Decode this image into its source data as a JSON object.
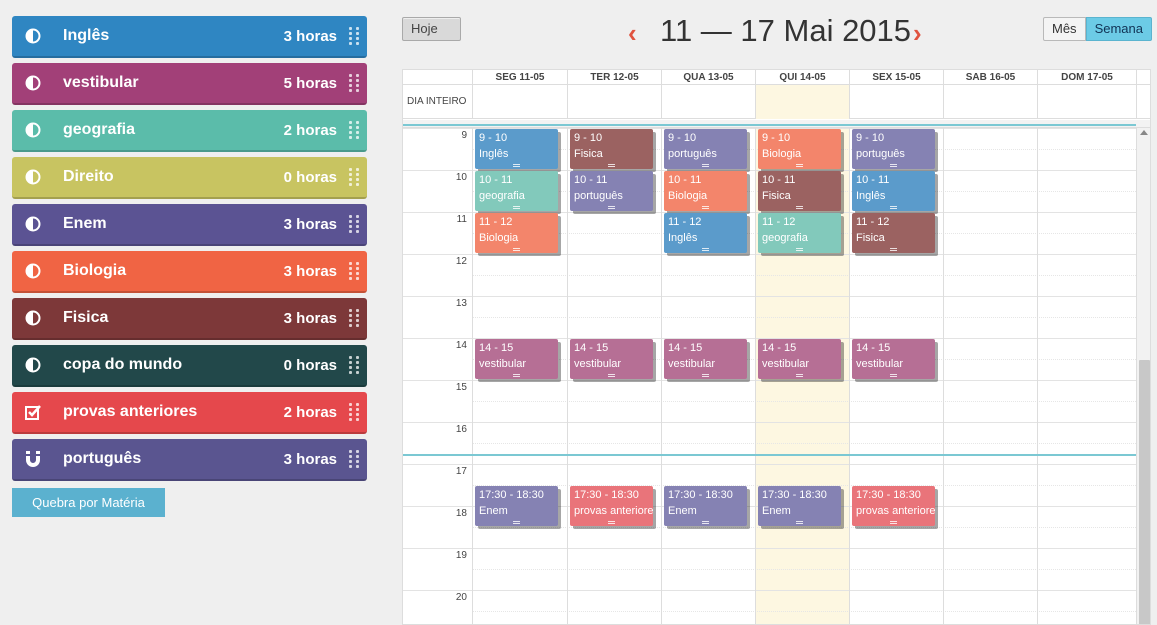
{
  "colors": {
    "ingles": "#2f86c2",
    "vestibular": "#a24078",
    "geografia": "#5bbcaa",
    "direito": "#c8c461",
    "enem": "#5b5393",
    "biologia": "#f06444",
    "fisica": "#7d3839",
    "copa": "#22484a",
    "provas": "#e5484c",
    "portugues": "#5a5590",
    "accent": "#5bb1cf",
    "nav": "#e0533f"
  },
  "sidebar": {
    "items": [
      {
        "name": "Inglês",
        "hours": "3 horas",
        "icon": "half-circle-icon",
        "color": "#2f86c2"
      },
      {
        "name": "vestibular",
        "hours": "5 horas",
        "icon": "half-circle-icon",
        "color": "#a24078"
      },
      {
        "name": "geografia",
        "hours": "2 horas",
        "icon": "half-circle-icon",
        "color": "#5bbcaa"
      },
      {
        "name": "Direito",
        "hours": "0 horas",
        "icon": "half-circle-icon",
        "color": "#c8c461"
      },
      {
        "name": "Enem",
        "hours": "3 horas",
        "icon": "half-circle-icon",
        "color": "#5b5393"
      },
      {
        "name": "Biologia",
        "hours": "3 horas",
        "icon": "half-circle-icon",
        "color": "#f06444"
      },
      {
        "name": "Fisica",
        "hours": "3 horas",
        "icon": "half-circle-icon",
        "color": "#7d3839"
      },
      {
        "name": "copa do mundo",
        "hours": "0 horas",
        "icon": "half-circle-icon",
        "color": "#22484a"
      },
      {
        "name": "provas anteriores",
        "hours": "2 horas",
        "icon": "checkbox-icon",
        "color": "#e5484c"
      },
      {
        "name": "português",
        "hours": "3 horas",
        "icon": "magnet-icon",
        "color": "#5a5590"
      }
    ],
    "breakdown_label": "Quebra por Matéria"
  },
  "toolbar": {
    "today_label": "Hoje",
    "prev_label": "‹",
    "next_label": "›",
    "week_title": "11 — 17 Mai 2015",
    "month_label": "Mês",
    "week_label": "Semana"
  },
  "calendar": {
    "allday_label": "DIA INTEIRO",
    "days": [
      "SEG 11-05",
      "TER 12-05",
      "QUA 13-05",
      "QUI 14-05",
      "SEX 15-05",
      "SAB 16-05",
      "DOM 17-05"
    ],
    "hours": [
      "9",
      "10",
      "11",
      "12",
      "13",
      "14",
      "15",
      "16",
      "17",
      "18",
      "19",
      "20"
    ],
    "events": [
      {
        "day": 0,
        "start": 9,
        "time": "9 - 10",
        "title": "Inglês",
        "color": "#5b9bcb"
      },
      {
        "day": 0,
        "start": 10,
        "time": "10 - 11",
        "title": "geografia",
        "color": "#82c9bb"
      },
      {
        "day": 0,
        "start": 11,
        "time": "11 - 12",
        "title": "Biologia",
        "color": "#f3856b"
      },
      {
        "day": 1,
        "start": 9,
        "time": "9 - 10",
        "title": "Fisica",
        "color": "#9b6261"
      },
      {
        "day": 1,
        "start": 10,
        "time": "10 - 11",
        "title": "português",
        "color": "#8582b3"
      },
      {
        "day": 2,
        "start": 9,
        "time": "9 - 10",
        "title": "português",
        "color": "#8582b3"
      },
      {
        "day": 2,
        "start": 10,
        "time": "10 - 11",
        "title": "Biologia",
        "color": "#f3856b"
      },
      {
        "day": 2,
        "start": 11,
        "time": "11 - 12",
        "title": "Inglês",
        "color": "#5b9bcb"
      },
      {
        "day": 3,
        "start": 9,
        "time": "9 - 10",
        "title": "Biologia",
        "color": "#f3856b"
      },
      {
        "day": 3,
        "start": 10,
        "time": "10 - 11",
        "title": "Fisica",
        "color": "#9b6261"
      },
      {
        "day": 3,
        "start": 11,
        "time": "11 - 12",
        "title": "geografia",
        "color": "#82c9bb"
      },
      {
        "day": 4,
        "start": 9,
        "time": "9 - 10",
        "title": "português",
        "color": "#8582b3"
      },
      {
        "day": 4,
        "start": 10,
        "time": "10 - 11",
        "title": "Inglês",
        "color": "#5b9bcb"
      },
      {
        "day": 4,
        "start": 11,
        "time": "11 - 12",
        "title": "Fisica",
        "color": "#9b6261"
      },
      {
        "day": 0,
        "start": 14,
        "time": "14 - 15",
        "title": "vestibular",
        "color": "#b66f95"
      },
      {
        "day": 1,
        "start": 14,
        "time": "14 - 15",
        "title": "vestibular",
        "color": "#b66f95"
      },
      {
        "day": 2,
        "start": 14,
        "time": "14 - 15",
        "title": "vestibular",
        "color": "#b66f95"
      },
      {
        "day": 3,
        "start": 14,
        "time": "14 - 15",
        "title": "vestibular",
        "color": "#b66f95"
      },
      {
        "day": 4,
        "start": 14,
        "time": "14 - 15",
        "title": "vestibular",
        "color": "#b66f95"
      },
      {
        "day": 0,
        "start": 17.5,
        "time": "17:30 - 18:30",
        "title": "Enem",
        "color": "#8582b3"
      },
      {
        "day": 1,
        "start": 17.5,
        "time": "17:30 - 18:30",
        "title": "provas anteriores",
        "color": "#e9747a"
      },
      {
        "day": 2,
        "start": 17.5,
        "time": "17:30 - 18:30",
        "title": "Enem",
        "color": "#8582b3"
      },
      {
        "day": 3,
        "start": 17.5,
        "time": "17:30 - 18:30",
        "title": "Enem",
        "color": "#8582b3"
      },
      {
        "day": 4,
        "start": 17.5,
        "time": "17:30 - 18:30",
        "title": "provas anteriores",
        "color": "#e9747a"
      }
    ]
  }
}
